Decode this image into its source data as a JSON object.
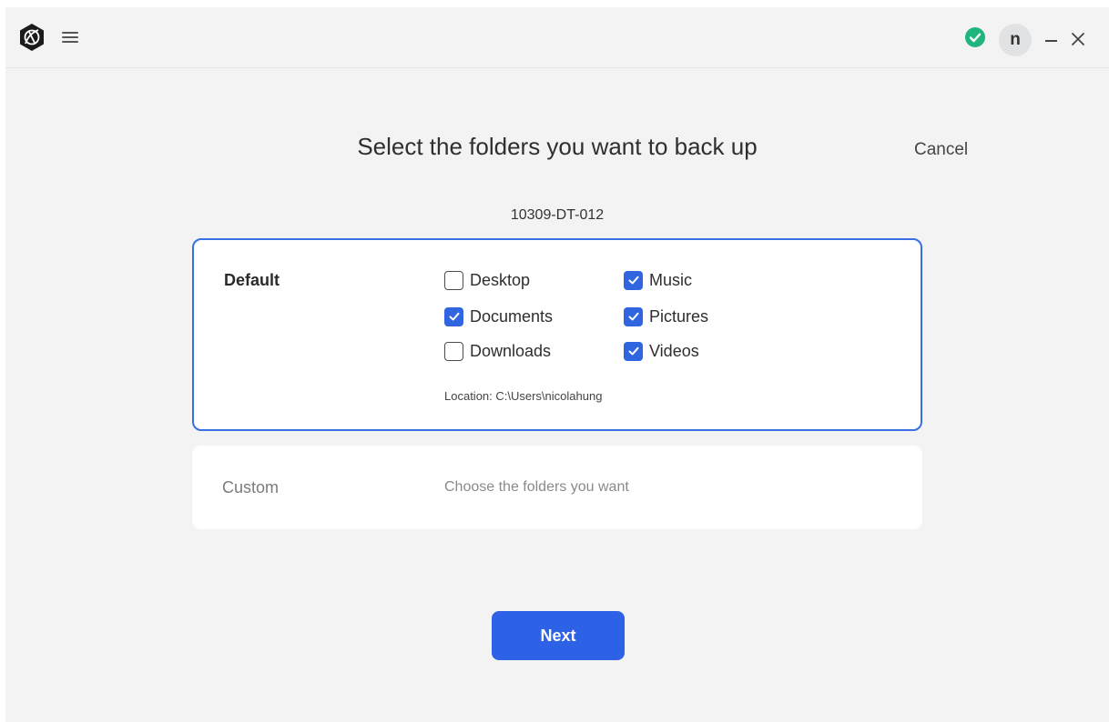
{
  "titlebar": {
    "menu_icon": "hamburger-menu-icon",
    "status_icon": "check-circle-icon",
    "status_color": "#1fb57c",
    "avatar_initial": "n",
    "minimize_icon": "minimize-icon",
    "close_icon": "close-icon"
  },
  "page": {
    "title": "Select the folders you want to back up",
    "cancel_label": "Cancel",
    "device_name": "10309-DT-012"
  },
  "default_option": {
    "label": "Default",
    "folders": [
      {
        "name": "Desktop",
        "checked": false
      },
      {
        "name": "Documents",
        "checked": true
      },
      {
        "name": "Downloads",
        "checked": false
      },
      {
        "name": "Music",
        "checked": true
      },
      {
        "name": "Pictures",
        "checked": true
      },
      {
        "name": "Videos",
        "checked": true
      }
    ],
    "location": "Location: C:\\Users\\nicolahung"
  },
  "custom_option": {
    "label": "Custom",
    "description": "Choose the folders you want"
  },
  "next_label": "Next",
  "colors": {
    "accent": "#2e62e6",
    "selected_border": "#3a6fe2",
    "background": "#f3f3f4"
  }
}
